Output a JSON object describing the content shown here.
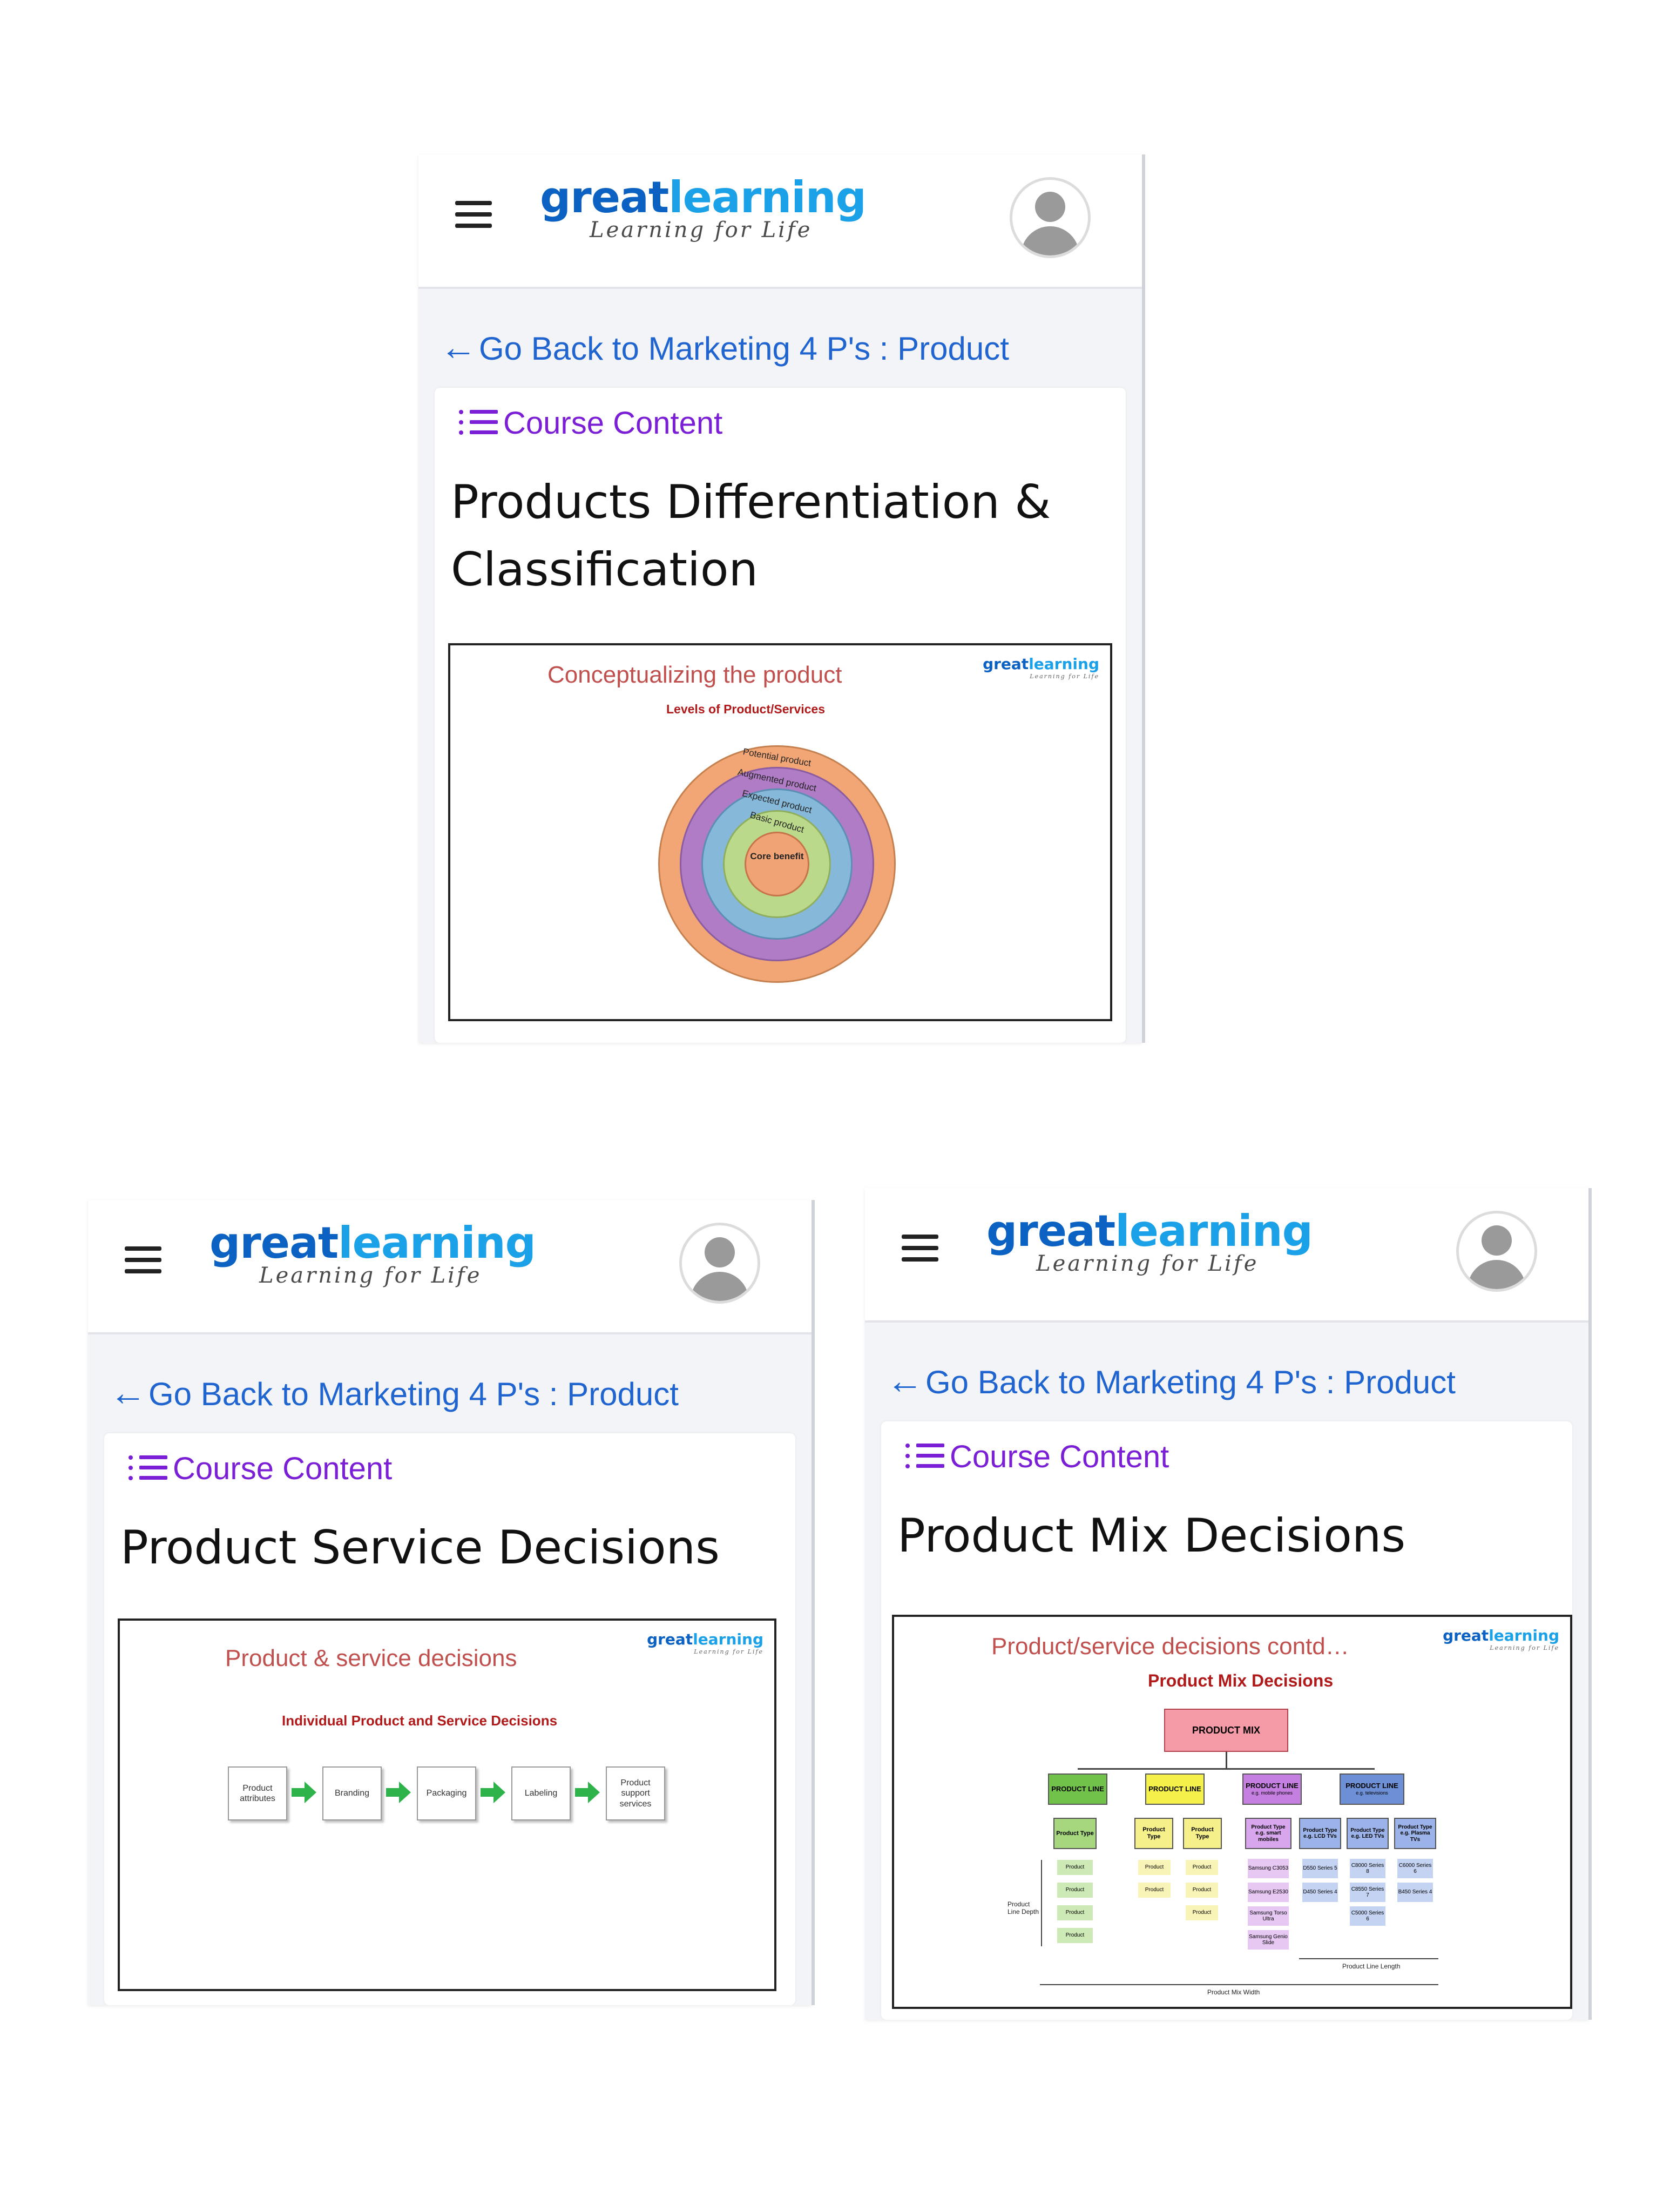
{
  "app": {
    "logo_word_1": "great",
    "logo_word_2": "learning",
    "logo_tagline": "Learning for Life",
    "brand_colors": {
      "great": "#0b62c2",
      "learning": "#1aa1e8",
      "link": "#1f64cf",
      "course_content": "#7b1fd6"
    }
  },
  "screens": [
    {
      "back_link": "Go Back to Marketing 4 P's : Product",
      "course_content_label": "Course Content",
      "lesson_title": "Products Differentiation & Classification",
      "slide": {
        "title": "Conceptualizing the product",
        "subtitle": "Levels of Product/Services",
        "rings": [
          "Potential product",
          "Augmented product",
          "Expected product",
          "Basic product"
        ],
        "core": "Core benefit"
      }
    },
    {
      "back_link": "Go Back to Marketing 4 P's : Product",
      "course_content_label": "Course Content",
      "lesson_title": "Product Service Decisions",
      "slide": {
        "title": "Product & service decisions",
        "subtitle": "Individual Product and Service Decisions",
        "steps": [
          "Product attributes",
          "Branding",
          "Packaging",
          "Labeling",
          "Product support services"
        ]
      }
    },
    {
      "back_link": "Go Back to Marketing 4 P's : Product",
      "course_content_label": "Course Content",
      "lesson_title": "Product Mix Decisions",
      "slide": {
        "title": "Product/service decisions contd…",
        "subtitle": "Product Mix Decisions",
        "root": "PRODUCT MIX",
        "lines": [
          "PRODUCT LINE",
          "PRODUCT LINE",
          "PRODUCT LINE",
          "PRODUCT LINE"
        ],
        "line_notes": [
          "",
          "",
          "e.g. mobile phones",
          "e.g. televisions"
        ],
        "product_type": "Product Type",
        "product": "Product",
        "types_line3": [
          "Product Type e.g. smart mobiles"
        ],
        "types_line4": [
          "Product Type e.g. LCD TVs",
          "Product Type e.g. LED TVs",
          "Product Type e.g. Plasma TVs"
        ],
        "items_line3": [
          "Samsung C3053",
          "Samsung E2530",
          "Samsung Torso Ultra",
          "Samsung Genio Slide"
        ],
        "items_line4": [
          "D550 Series 5",
          "D450 Series 4",
          "C8000 Series 8",
          "C8550 Series 7",
          "C5000 Series 6",
          "C6000 Series 6",
          "B450 Series 4"
        ],
        "depth_label": "Product Line Depth",
        "length_label": "Product Line Length",
        "width_label": "Product Mix Width"
      }
    }
  ]
}
